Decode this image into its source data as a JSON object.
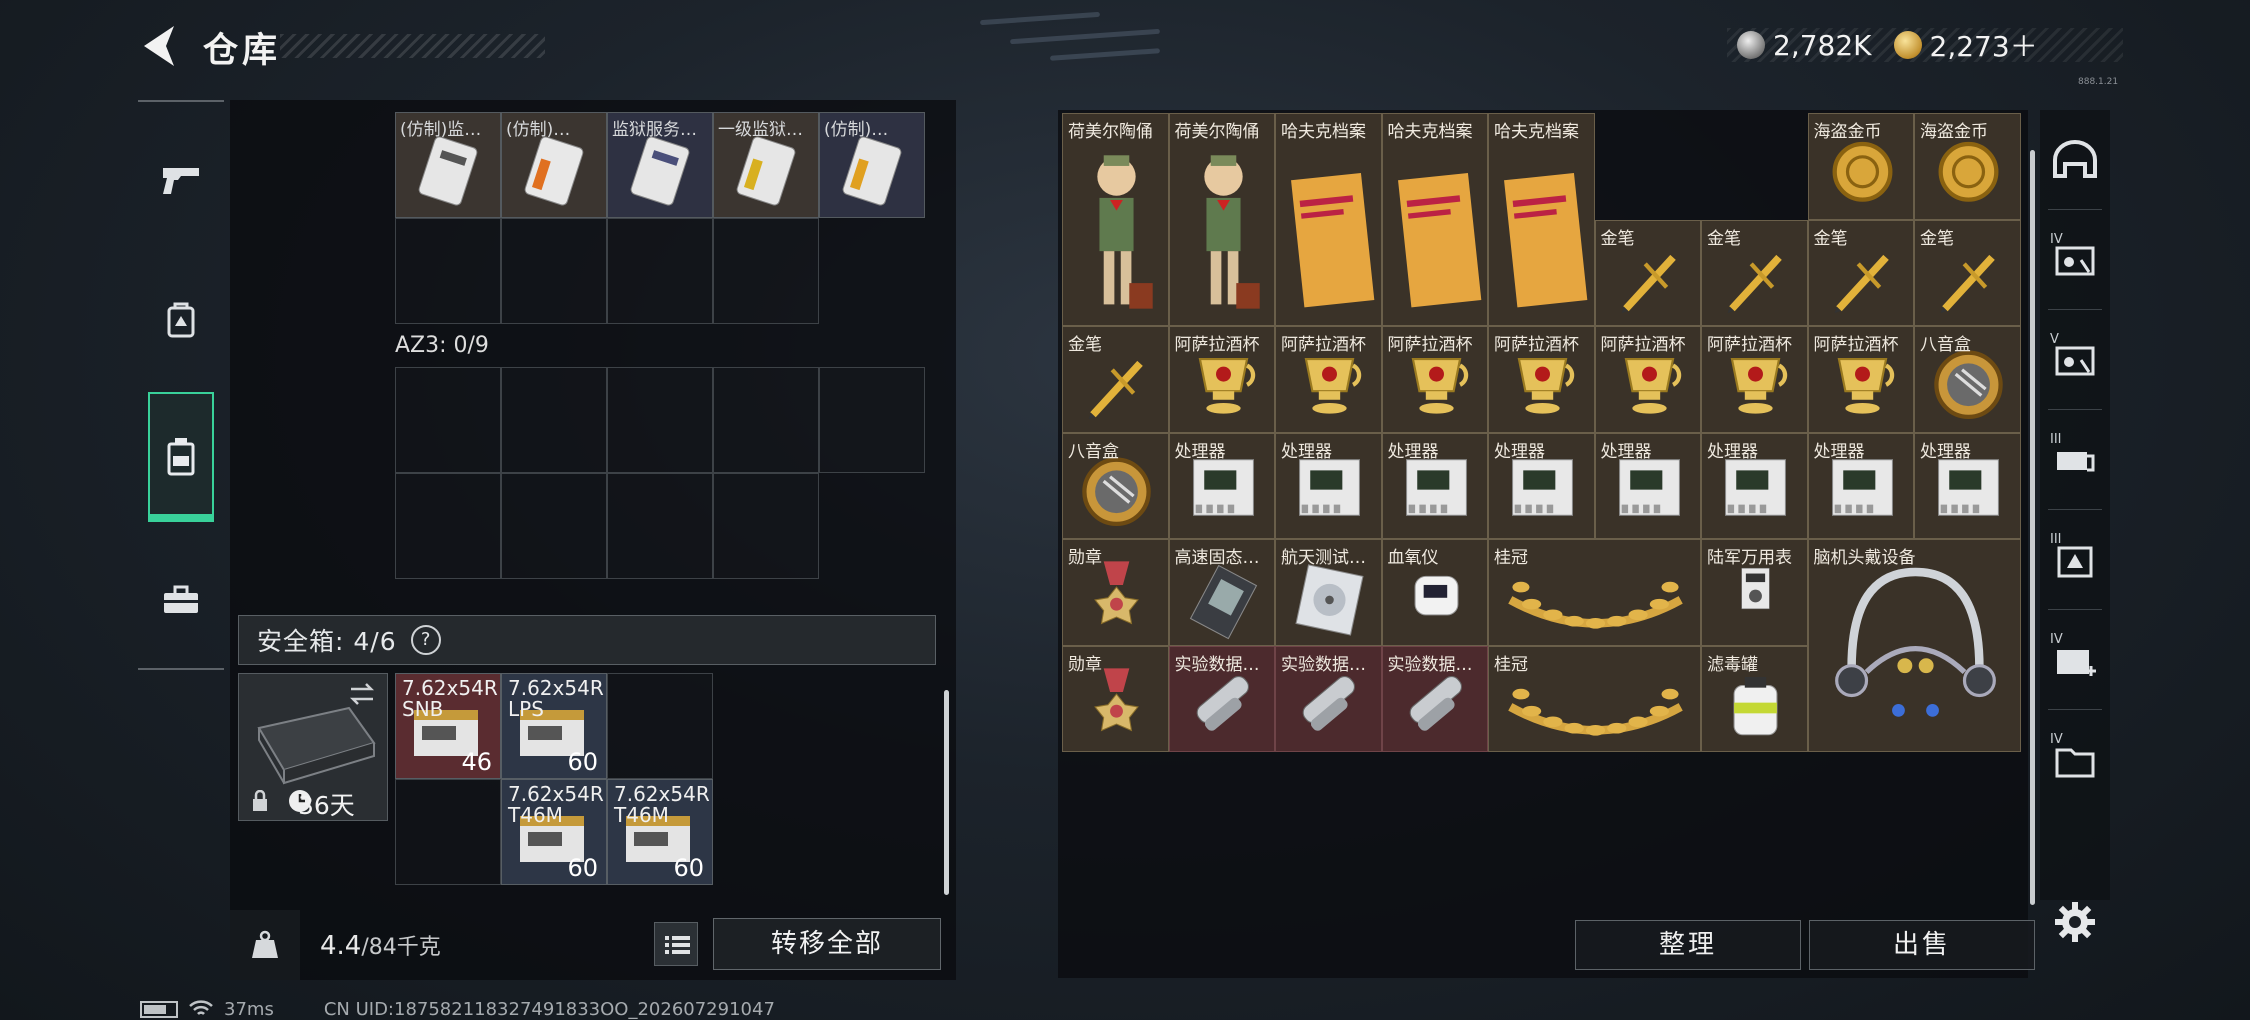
{
  "header": {
    "title": "仓库",
    "currencies": [
      {
        "icon": "silver-coin-icon",
        "value": "2,782K"
      },
      {
        "icon": "gold-coin-icon",
        "value": "2,273＋"
      }
    ],
    "tiny_text": "888.1.21"
  },
  "left_nav": {
    "items": [
      {
        "name": "weapon",
        "icon": "pistol-icon",
        "active": false
      },
      {
        "name": "gear",
        "icon": "backpack-gear-icon",
        "active": false
      },
      {
        "name": "storage",
        "icon": "container-icon",
        "active": true
      },
      {
        "name": "toolbox",
        "icon": "toolbox-icon",
        "active": false
      }
    ]
  },
  "left_panel": {
    "top_items": [
      "(仿制)监…",
      "(仿制)…",
      "监狱服务…",
      "一级监狱…",
      "(仿制)…"
    ],
    "az3_label": "AZ3: 0/9",
    "safe_box": {
      "label": "安全箱: 4/6",
      "help": "?",
      "days": "36天",
      "ammo": [
        {
          "caliber": "7.62x54R\nSNB",
          "qty": "46"
        },
        {
          "caliber": "7.62x54R\nLPS",
          "qty": "60"
        },
        {
          "caliber": "7.62x54R\nT46M",
          "qty": "60"
        },
        {
          "caliber": "7.62x54R\nT46M",
          "qty": "60"
        }
      ]
    },
    "weight": {
      "value": "4.4",
      "unit": "/84千克"
    },
    "transfer_all": "转移全部"
  },
  "right_panel": {
    "item_names": {
      "figurine": "荷美尔陶俑",
      "dossier": "哈夫克档案",
      "pirate_coin": "海盗金币",
      "gold_pen": "金笔",
      "cup": "阿萨拉酒杯",
      "music_box": "八音盒",
      "processor": "处理器",
      "medal": "勋章",
      "ssd": "高速固态…",
      "aero_disk": "航天测试…",
      "oximeter": "血氧仪",
      "laurel": "桂冠",
      "multimeter": "陆军万用表",
      "bci": "脑机头戴设备",
      "lab_data": "实验数据…",
      "filter": "滤毒罐"
    },
    "organize": "整理",
    "sell": "出售"
  },
  "right_nav": {
    "items": [
      {
        "icon": "helmet-icon",
        "level": ""
      },
      {
        "icon": "vest-icon",
        "level": "IV"
      },
      {
        "icon": "vest-icon",
        "level": "V"
      },
      {
        "icon": "chest-rig-icon",
        "level": "III"
      },
      {
        "icon": "backpack-icon",
        "level": "III"
      },
      {
        "icon": "medical-case-icon",
        "level": "IV"
      },
      {
        "icon": "folder-case-icon",
        "level": "IV"
      }
    ]
  },
  "status_bar": {
    "ping": "37ms",
    "uid": "CN UID:187582118327491833OO_202607291047"
  }
}
